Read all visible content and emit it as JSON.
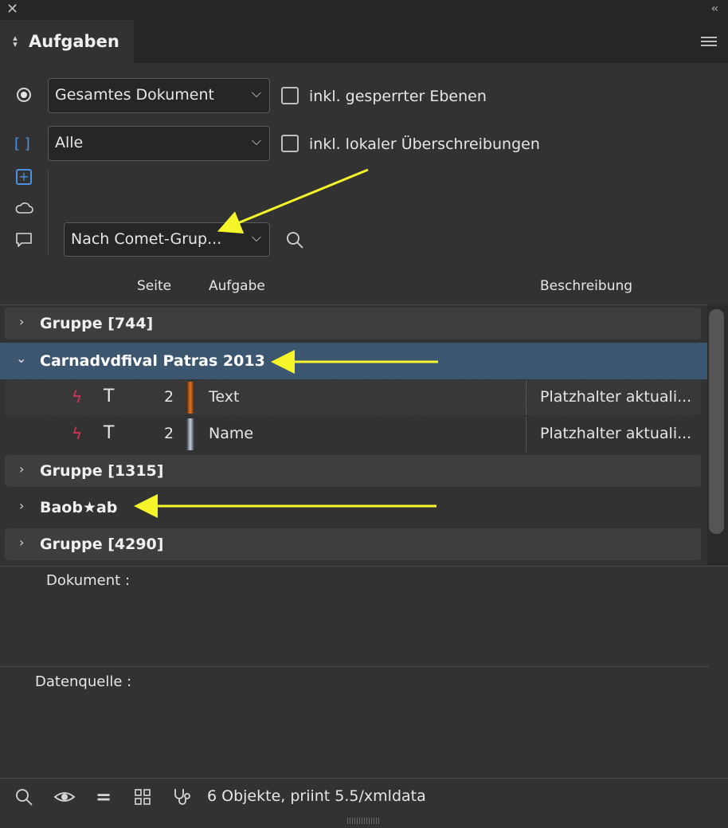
{
  "window": {
    "close_glyph": "✕",
    "collapse_glyph": "‹‹"
  },
  "panel": {
    "title": "Aufgaben",
    "menu_icon": "hamburger-menu-icon"
  },
  "filters": {
    "scope_select": "Gesamtes Dokument",
    "locked_layers_label": "inkl. gesperrter Ebenen",
    "type_select": "Alle",
    "local_overrides_label": "inkl. lokaler Überschreibungen",
    "group_select": "Nach Comet-Grup..."
  },
  "columns": {
    "page": "Seite",
    "task": "Aufgabe",
    "description": "Beschreibung"
  },
  "tree": {
    "group1": "Gruppe [744]",
    "group2": "Carnadvdfival Patras 2013",
    "tasks": [
      {
        "page": "2",
        "task": "Text",
        "description": "Platzhalter aktuali...",
        "color": "#e8731a"
      },
      {
        "page": "2",
        "task": "Name",
        "description": "Platzhalter aktuali...",
        "color": "#9aa6b8"
      }
    ],
    "group3": "Gruppe [1315]",
    "group4": "Baob★ab",
    "group5": "Gruppe [4290]"
  },
  "info": {
    "document_label": "Dokument :",
    "datasource_label": "Datenquelle :"
  },
  "footer": {
    "status": "6 Objekte, priint 5.5/xmldata"
  },
  "colors": {
    "accent": "#4d8fe0",
    "selection": "#3d5670",
    "bolt": "#d8335a",
    "annotation": "#f5f52a"
  }
}
